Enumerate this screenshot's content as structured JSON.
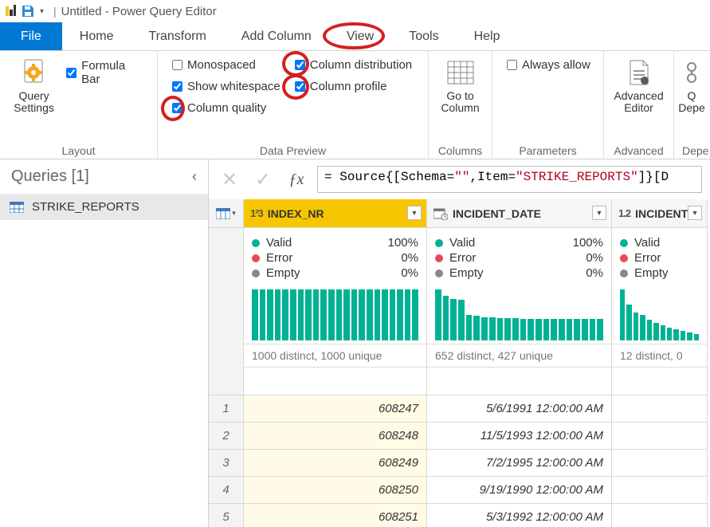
{
  "titlebar": {
    "title": "Untitled - Power Query Editor"
  },
  "tabs": {
    "file": "File",
    "home": "Home",
    "transform": "Transform",
    "addcol": "Add Column",
    "view": "View",
    "tools": "Tools",
    "help": "Help"
  },
  "ribbon": {
    "layout": {
      "query_settings": "Query\nSettings",
      "formula_bar": "Formula Bar",
      "group": "Layout"
    },
    "preview": {
      "monospaced": "Monospaced",
      "whitespace": "Show whitespace",
      "quality": "Column quality",
      "distribution": "Column distribution",
      "profile": "Column profile",
      "group": "Data Preview"
    },
    "columns": {
      "goto": "Go to\nColumn",
      "group": "Columns"
    },
    "params": {
      "always": "Always allow",
      "group": "Parameters"
    },
    "advanced": {
      "editor": "Advanced\nEditor",
      "group": "Advanced"
    },
    "depend": {
      "btn": "Depe…",
      "group": "Depe",
      "btn_short": "Q"
    }
  },
  "queries": {
    "header": "Queries [1]",
    "item": "STRIKE_REPORTS"
  },
  "formula": {
    "prefix": "= Source{[Schema=",
    "schema": "\"\"",
    "mid": ",Item=",
    "item": "\"STRIKE_REPORTS\"",
    "suffix": "]}[D"
  },
  "columns_data": [
    {
      "name": "INDEX_NR",
      "type": "1²3",
      "selected": true,
      "stats": {
        "valid": "100%",
        "error": "0%",
        "empty": "0%"
      },
      "labels": {
        "valid": "Valid",
        "error": "Error",
        "empty": "Empty"
      },
      "footer": "1000 distinct, 1000 unique",
      "bars": [
        100,
        100,
        100,
        100,
        100,
        100,
        100,
        100,
        100,
        100,
        100,
        100,
        100,
        100,
        100,
        100,
        100,
        100,
        100,
        100,
        100,
        100
      ]
    },
    {
      "name": "INCIDENT_DATE",
      "type": "cal",
      "selected": false,
      "stats": {
        "valid": "100%",
        "error": "0%",
        "empty": "0%"
      },
      "labels": {
        "valid": "Valid",
        "error": "Error",
        "empty": "Empty"
      },
      "footer": "652 distinct, 427 unique",
      "bars": [
        100,
        88,
        82,
        80,
        50,
        48,
        46,
        46,
        44,
        44,
        44,
        42,
        42,
        42,
        42,
        42,
        42,
        42,
        42,
        42,
        42,
        42
      ]
    },
    {
      "name": "INCIDENT",
      "type": "1.2",
      "selected": false,
      "stats": {
        "valid": "",
        "error": "",
        "empty": ""
      },
      "labels": {
        "valid": "Valid",
        "error": "Error",
        "empty": "Empty"
      },
      "footer": "12 distinct, 0",
      "bars": [
        100,
        70,
        55,
        50,
        40,
        35,
        30,
        25,
        22,
        18,
        15,
        12
      ]
    }
  ],
  "rows": [
    {
      "n": "1",
      "index": "608247",
      "date": "5/6/1991 12:00:00 AM"
    },
    {
      "n": "2",
      "index": "608248",
      "date": "11/5/1993 12:00:00 AM"
    },
    {
      "n": "3",
      "index": "608249",
      "date": "7/2/1995 12:00:00 AM"
    },
    {
      "n": "4",
      "index": "608250",
      "date": "9/19/1990 12:00:00 AM"
    },
    {
      "n": "5",
      "index": "608251",
      "date": "5/3/1992 12:00:00 AM"
    }
  ]
}
